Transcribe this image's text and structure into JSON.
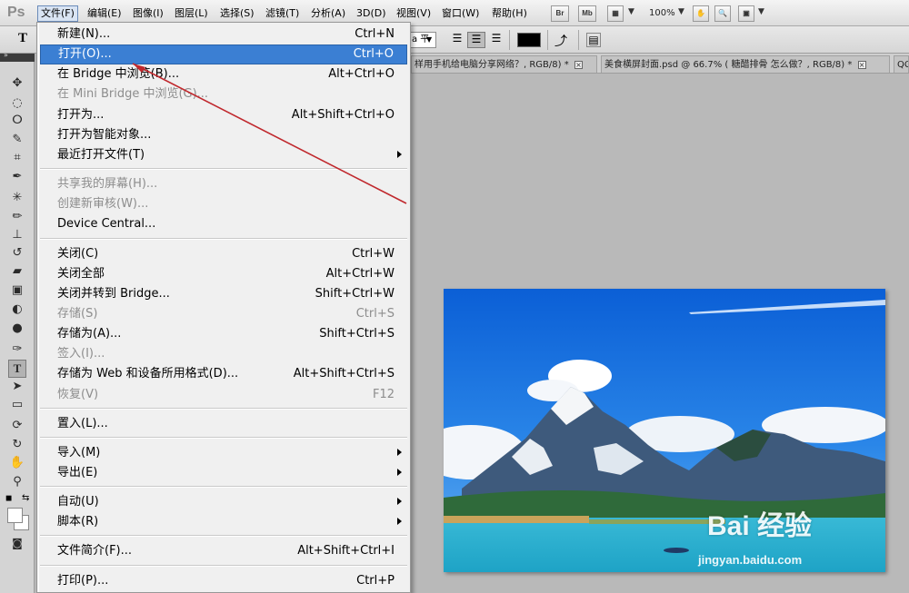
{
  "app": {
    "logo": "Ps"
  },
  "menubar": {
    "items": [
      {
        "label": "文件(F)"
      },
      {
        "label": "编辑(E)"
      },
      {
        "label": "图像(I)"
      },
      {
        "label": "图层(L)"
      },
      {
        "label": "选择(S)"
      },
      {
        "label": "滤镜(T)"
      },
      {
        "label": "分析(A)"
      },
      {
        "label": "3D(D)"
      },
      {
        "label": "视图(V)"
      },
      {
        "label": "窗口(W)"
      },
      {
        "label": "帮助(H)"
      }
    ],
    "br_label": "Br",
    "mb_label": "Mb",
    "zoom": "100%"
  },
  "options_bar": {
    "tool_label": "T",
    "dropdown_value": "a 平滑"
  },
  "tabs": [
    {
      "title": "样用手机给电脑分享网络？, RGB/8) *",
      "close": "×"
    },
    {
      "title": "美食横屏封面.psd @ 66.7% ( 糖醋排骨 怎么做？, RGB/8) *",
      "close": "×"
    },
    {
      "title": "QC",
      "close": ""
    }
  ],
  "file_menu": {
    "groups": [
      [
        {
          "label": "新建(N)...",
          "shortcut": "Ctrl+N",
          "disabled": false,
          "highlighted": false
        },
        {
          "label": "打开(O)...",
          "shortcut": "Ctrl+O",
          "disabled": false,
          "highlighted": true
        },
        {
          "label": "在 Bridge 中浏览(B)...",
          "shortcut": "Alt+Ctrl+O",
          "disabled": false
        },
        {
          "label": "在 Mini Bridge 中浏览(G)...",
          "shortcut": "",
          "disabled": true
        },
        {
          "label": "打开为...",
          "shortcut": "Alt+Shift+Ctrl+O",
          "disabled": false
        },
        {
          "label": "打开为智能对象...",
          "shortcut": "",
          "disabled": false
        },
        {
          "label": "最近打开文件(T)",
          "shortcut": "",
          "disabled": false,
          "submenu": true
        }
      ],
      [
        {
          "label": "共享我的屏幕(H)...",
          "shortcut": "",
          "disabled": true
        },
        {
          "label": "创建新审核(W)...",
          "shortcut": "",
          "disabled": true
        },
        {
          "label": "Device Central...",
          "shortcut": "",
          "disabled": false
        }
      ],
      [
        {
          "label": "关闭(C)",
          "shortcut": "Ctrl+W",
          "disabled": false
        },
        {
          "label": "关闭全部",
          "shortcut": "Alt+Ctrl+W",
          "disabled": false
        },
        {
          "label": "关闭并转到 Bridge...",
          "shortcut": "Shift+Ctrl+W",
          "disabled": false
        },
        {
          "label": "存储(S)",
          "shortcut": "Ctrl+S",
          "disabled": true
        },
        {
          "label": "存储为(A)...",
          "shortcut": "Shift+Ctrl+S",
          "disabled": false
        },
        {
          "label": "签入(I)...",
          "shortcut": "",
          "disabled": true
        },
        {
          "label": "存储为 Web 和设备所用格式(D)...",
          "shortcut": "Alt+Shift+Ctrl+S",
          "disabled": false
        },
        {
          "label": "恢复(V)",
          "shortcut": "F12",
          "disabled": true
        }
      ],
      [
        {
          "label": "置入(L)...",
          "shortcut": "",
          "disabled": false
        }
      ],
      [
        {
          "label": "导入(M)",
          "shortcut": "",
          "disabled": false,
          "submenu": true
        },
        {
          "label": "导出(E)",
          "shortcut": "",
          "disabled": false,
          "submenu": true
        }
      ],
      [
        {
          "label": "自动(U)",
          "shortcut": "",
          "disabled": false,
          "submenu": true
        },
        {
          "label": "脚本(R)",
          "shortcut": "",
          "disabled": false,
          "submenu": true
        }
      ],
      [
        {
          "label": "文件简介(F)...",
          "shortcut": "Alt+Shift+Ctrl+I",
          "disabled": false
        }
      ],
      [
        {
          "label": "打印(P)...",
          "shortcut": "Ctrl+P",
          "disabled": false
        }
      ]
    ]
  },
  "watermark": {
    "brand": "Bai 经验",
    "url": "jingyan.baidu.com"
  },
  "colors": {
    "highlight": "#3b7fd3",
    "annotation_arrow": "#c0282d",
    "foreground_swatch": "#000000"
  }
}
